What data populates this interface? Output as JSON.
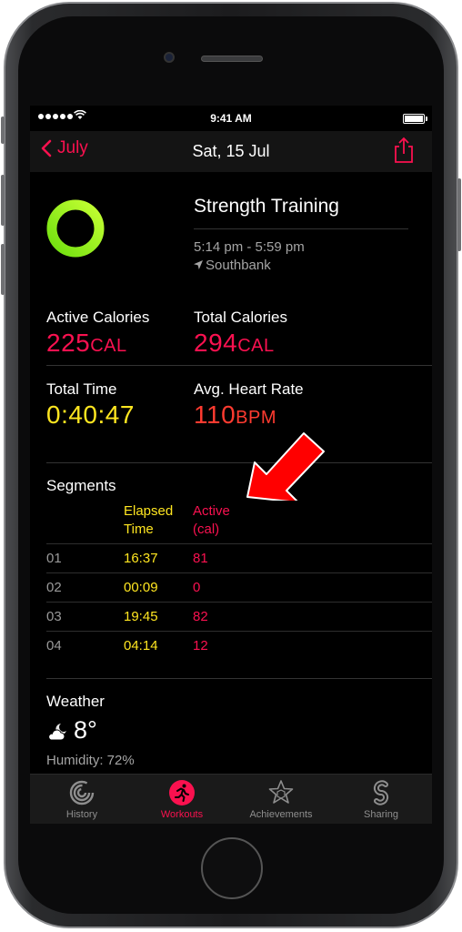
{
  "status_bar": {
    "time": "9:41 AM"
  },
  "nav": {
    "back_label": "July",
    "title": "Sat, 15 Jul"
  },
  "workout": {
    "title": "Strength Training",
    "time_range": "5:14 pm - 5:59 pm",
    "location": "Southbank",
    "ring_colors": [
      "#7bea12",
      "#c8ff30"
    ]
  },
  "stats": {
    "active_calories": {
      "label": "Active Calories",
      "value": "225",
      "unit": "CAL",
      "color": "#fa1150"
    },
    "total_calories": {
      "label": "Total Calories",
      "value": "294",
      "unit": "CAL",
      "color": "#fa1150"
    },
    "total_time": {
      "label": "Total Time",
      "value": "0:40:47",
      "color": "#ffe620"
    },
    "avg_heart_rate": {
      "label": "Avg. Heart Rate",
      "value": "110",
      "unit": "BPM",
      "color": "#ff3b30"
    }
  },
  "segments": {
    "title": "Segments",
    "header_elapsed_line1": "Elapsed",
    "header_elapsed_line2": "Time",
    "header_active_line1": "Active",
    "header_active_line2": "(cal)",
    "rows": [
      {
        "num": "01",
        "time": "16:37",
        "cal": "81"
      },
      {
        "num": "02",
        "time": "00:09",
        "cal": "0"
      },
      {
        "num": "03",
        "time": "19:45",
        "cal": "82"
      },
      {
        "num": "04",
        "time": "04:14",
        "cal": "12"
      }
    ]
  },
  "weather": {
    "title": "Weather",
    "icon": "partly-cloudy-night-icon",
    "temperature": "8°",
    "humidity": "Humidity: 72%"
  },
  "tabs": [
    {
      "label": "History",
      "icon": "history-rings-icon",
      "active": false
    },
    {
      "label": "Workouts",
      "icon": "running-figure-icon",
      "active": true
    },
    {
      "label": "Achievements",
      "icon": "star-badge-icon",
      "active": false
    },
    {
      "label": "Sharing",
      "icon": "sharing-s-icon",
      "active": false
    }
  ],
  "colors": {
    "accent": "#fa114f",
    "calories": "#fa1150",
    "time": "#ffe620",
    "heart_rate": "#ff3b30",
    "annotation_arrow": "#ff0000"
  }
}
